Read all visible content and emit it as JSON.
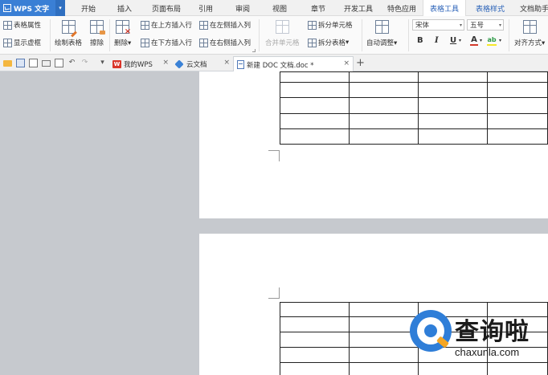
{
  "app": {
    "name": "WPS 文字",
    "dropdown_glyph": "▾"
  },
  "menu": {
    "tabs": [
      "开始",
      "插入",
      "页面布局",
      "引用",
      "审阅",
      "视图",
      "章节",
      "开发工具",
      "特色应用",
      "表格工具",
      "表格样式",
      "文档助手"
    ],
    "active": "表格工具"
  },
  "ribbon": {
    "table_properties": "表格属性",
    "show_gridlines": "显示虚框",
    "draw_table": "绘制表格",
    "eraser": "擦除",
    "delete": "删除",
    "delete_arrow": "▾",
    "insert_row_above": "在上方插入行",
    "insert_row_below": "在下方插入行",
    "insert_col_left": "在左侧插入列",
    "insert_col_right": "在右侧插入列",
    "merge_cells": "合并单元格",
    "split_cells": "拆分单元格",
    "split_table": "拆分表格",
    "split_table_arrow": "▾",
    "auto_fit": "自动调整",
    "auto_fit_arrow": "▾",
    "font_name": "宋体",
    "font_size": "五号",
    "bold": "B",
    "italic": "I",
    "underline": "U",
    "font_color": "A",
    "highlight": "ab",
    "align": "对齐方式",
    "align_arrow": "▾",
    "combo_arrow": "▾",
    "colors": {
      "font_color_bar": "#d23a2b",
      "highlight_bar": "#f5e82a"
    }
  },
  "tabbar": {
    "quick_access_icons": [
      "open-folder-icon",
      "save-icon",
      "export-pdf-icon",
      "print-icon",
      "print-preview-icon",
      "undo-icon",
      "redo-icon"
    ],
    "undo_glyph": "↶",
    "redo_glyph": "↷",
    "more_glyph": "▾",
    "tabs": [
      {
        "label": "我的WPS",
        "icon": "W"
      },
      {
        "label": "云文档"
      },
      {
        "label": "新建 DOC 文档.doc *"
      }
    ],
    "close_glyph": "×",
    "new_tab_glyph": "+"
  },
  "document": {
    "table_rows_page1": 4,
    "table_rows_page2": 5,
    "table_cols": 4
  },
  "watermark": {
    "brand": "查询啦",
    "url": "chaxunla.com"
  },
  "colors": {
    "accent": "#3a7fd5",
    "active_menu_text": "#2a62b8",
    "workspace_bg": "#c6c9ce"
  }
}
